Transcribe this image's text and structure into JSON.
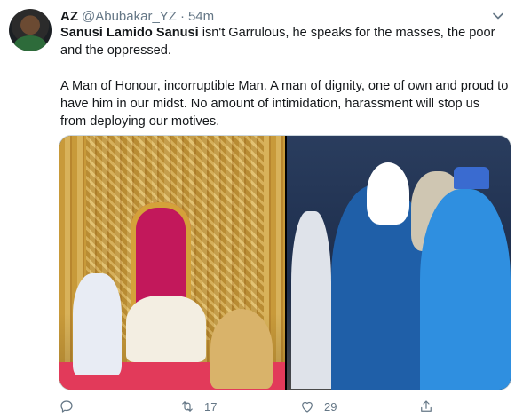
{
  "tweet": {
    "display_name": "AZ",
    "handle": "@Abubakar_YZ",
    "separator": "·",
    "time": "54m",
    "mention": "Sanusi Lamido Sanusi",
    "line1_rest": " isn't Garrulous, he speaks for the masses, the poor and the oppressed.",
    "paragraph2": "A Man of Honour, incorruptible Man. A man of dignity, one of own and proud to have him in our midst. No amount of intimidation, harassment will stop us from deploying our motives."
  },
  "actions": {
    "reply_icon": "reply-icon",
    "retweet_icon": "retweet-icon",
    "retweet_count": "17",
    "like_icon": "heart-icon",
    "like_count": "29",
    "share_icon": "share-icon"
  },
  "colors": {
    "text": "#14171a",
    "secondary": "#657786",
    "border": "#ccd6dd"
  }
}
